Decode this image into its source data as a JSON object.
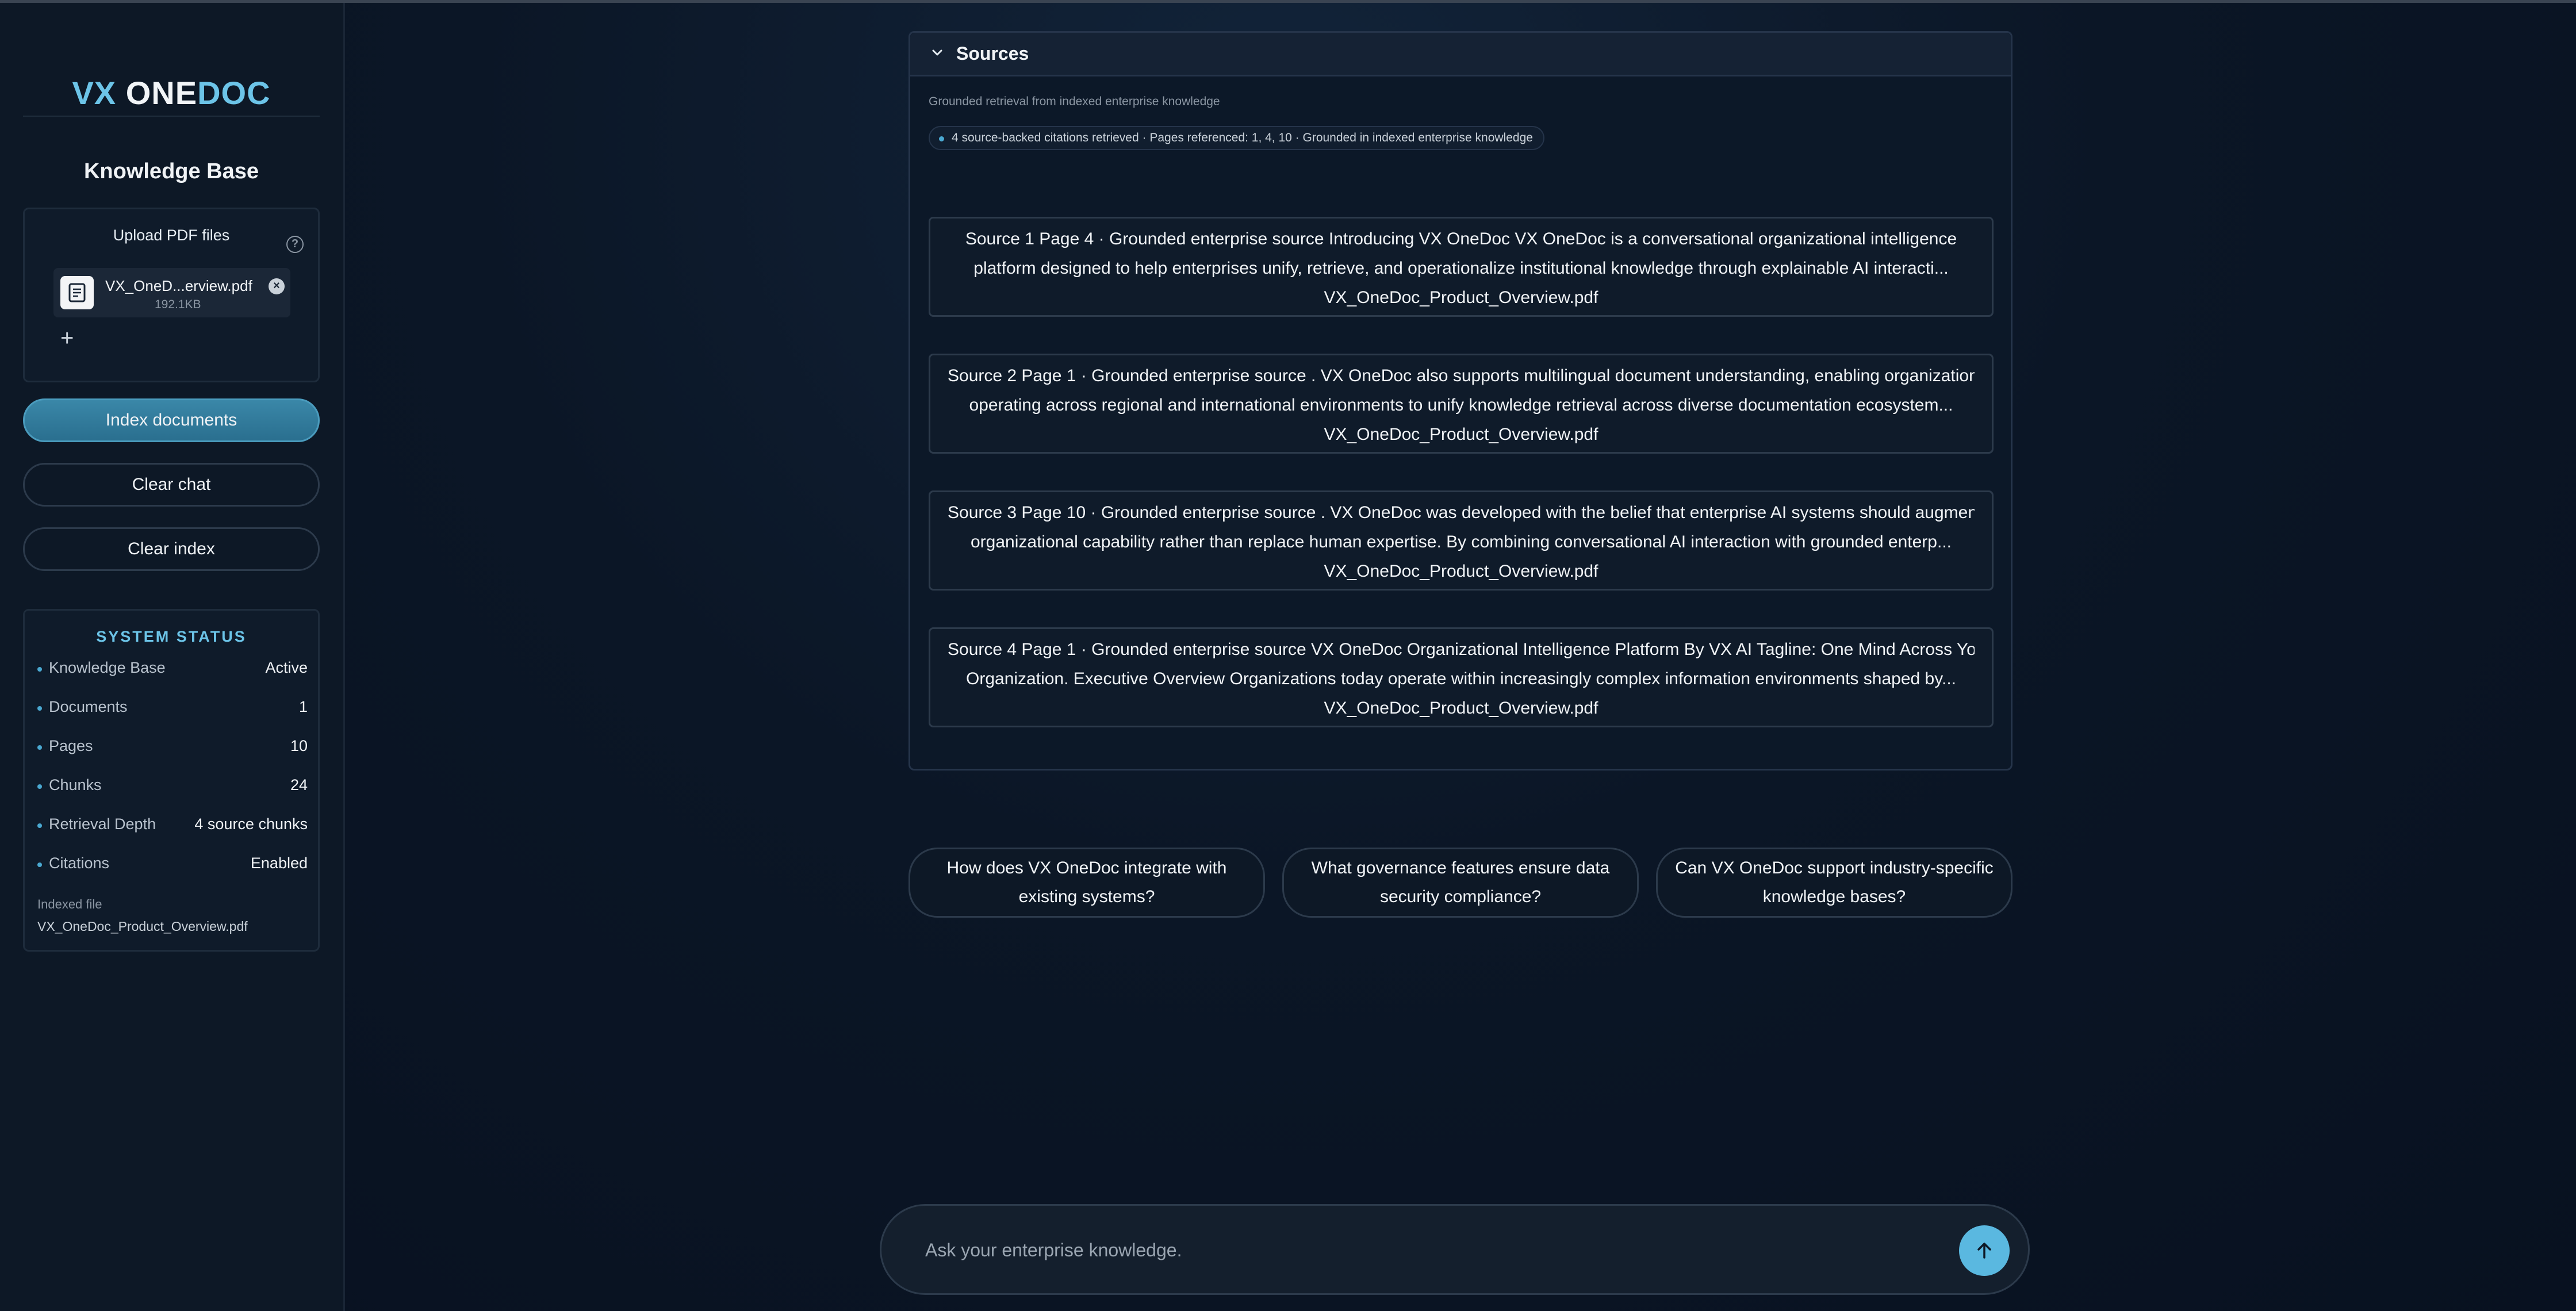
{
  "app": {
    "logo_part1": "VX ",
    "logo_part2": "ONE",
    "logo_part3": "DOC"
  },
  "sidebar": {
    "title": "Knowledge Base",
    "upload": {
      "label": "Upload PDF files",
      "help_icon": "question-circle-icon",
      "file": {
        "name": "VX_OneD...erview.pdf",
        "size": "192.1KB"
      },
      "add_label": "+"
    },
    "buttons": {
      "index": "Index documents",
      "clear_chat": "Clear chat",
      "clear_index": "Clear index"
    },
    "status": {
      "title": "SYSTEM STATUS",
      "rows": [
        {
          "key": "Knowledge Base",
          "value": "Active"
        },
        {
          "key": "Documents",
          "value": "1"
        },
        {
          "key": "Pages",
          "value": "10"
        },
        {
          "key": "Chunks",
          "value": "24"
        },
        {
          "key": "Retrieval Depth",
          "value": "4 source chunks"
        },
        {
          "key": "Citations",
          "value": "Enabled"
        }
      ],
      "indexed_label": "Indexed file",
      "indexed_file": "VX_OneDoc_Product_Overview.pdf"
    }
  },
  "sources": {
    "title": "Sources",
    "subtitle": "Grounded retrieval from indexed enterprise knowledge",
    "citation_summary": "4 source-backed citations retrieved · Pages referenced: 1, 4, 10 · Grounded in indexed enterprise knowledge",
    "cards": [
      {
        "line1": "Source 1 Page 4 · Grounded enterprise source Introducing VX OneDoc VX OneDoc is a conversational organizational intelligence",
        "line2": "platform designed to help enterprises unify, retrieve, and operationalize institutional knowledge through explainable AI interacti...",
        "line3": "VX_OneDoc_Product_Overview.pdf"
      },
      {
        "line1": "Source 2 Page 1 · Grounded enterprise source . VX OneDoc also supports multilingual document understanding, enabling organizations",
        "line2": "operating across regional and international environments to unify knowledge retrieval across diverse documentation ecosystem...",
        "line3": "VX_OneDoc_Product_Overview.pdf"
      },
      {
        "line1": "Source 3 Page 10 · Grounded enterprise source . VX OneDoc was developed with the belief that enterprise AI systems should augment",
        "line2": "organizational capability rather than replace human expertise. By combining conversational AI interaction with grounded enterp...",
        "line3": "VX_OneDoc_Product_Overview.pdf"
      },
      {
        "line1": "Source 4 Page 1 · Grounded enterprise source VX OneDoc Organizational Intelligence Platform By VX AI Tagline: One Mind Across Your",
        "line2": "Organization. Executive Overview Organizations today operate within increasingly complex information environments shaped by...",
        "line3": "VX_OneDoc_Product_Overview.pdf"
      }
    ]
  },
  "suggestions": [
    "How does VX OneDoc integrate with existing systems?",
    "What governance features ensure data security compliance?",
    "Can VX OneDoc support industry-specific knowledge bases?"
  ],
  "chat": {
    "placeholder": "Ask your enterprise knowledge.",
    "send_icon": "arrow-up-icon"
  },
  "colors": {
    "accent": "#6cc4e8",
    "primary_button": "#2a6f8f",
    "background": "#0b1626"
  }
}
